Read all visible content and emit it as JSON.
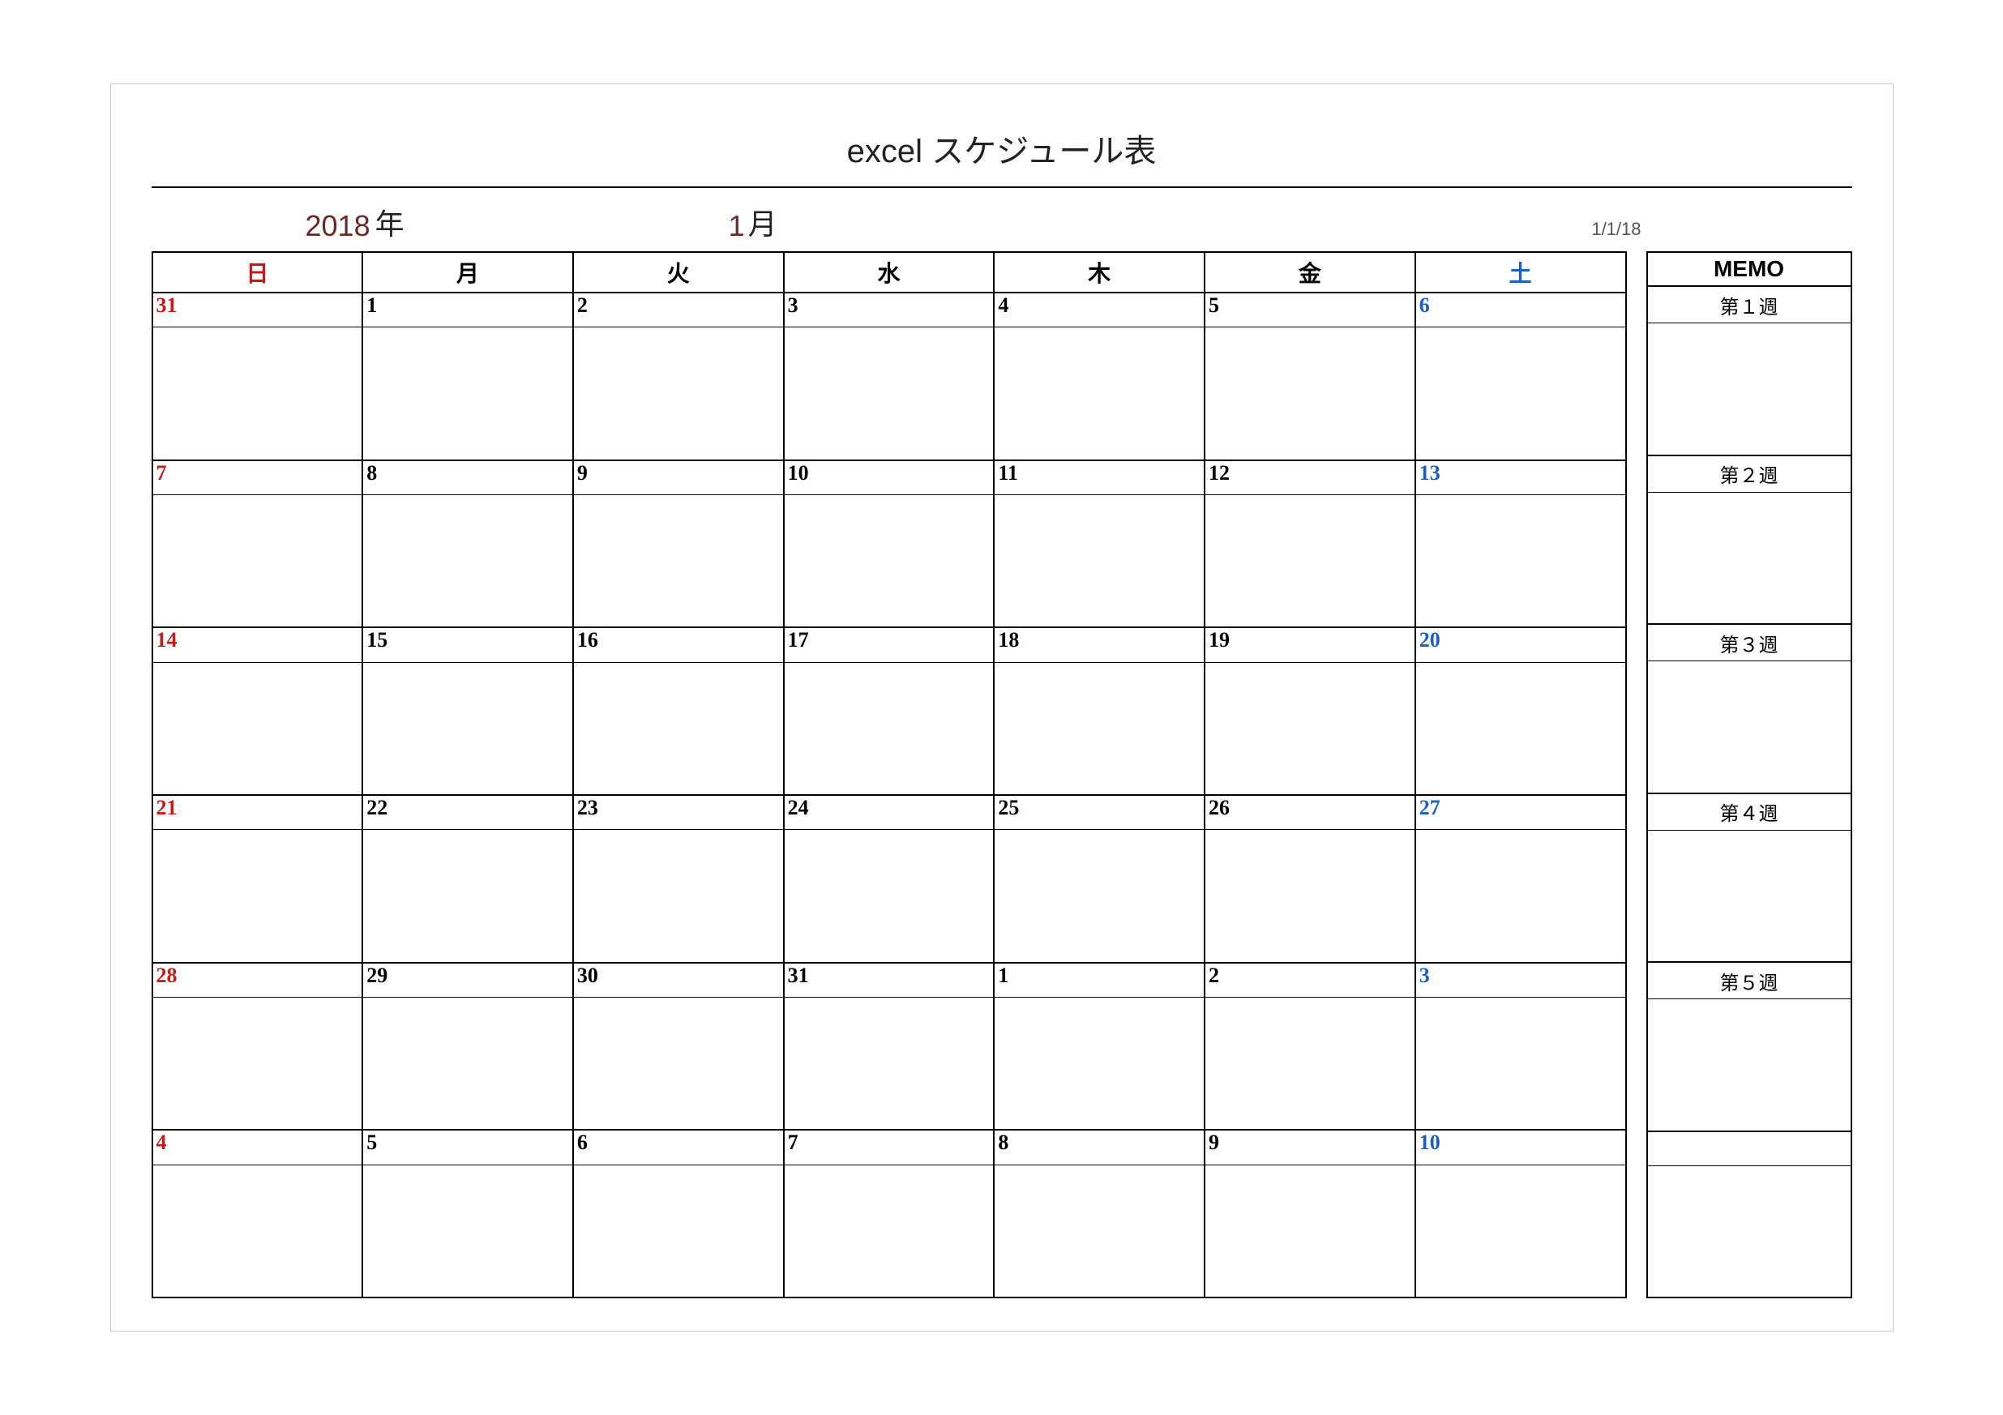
{
  "title": "excel スケジュール表",
  "year": "2018",
  "year_suffix": "年",
  "month": "1",
  "month_suffix": "月",
  "ref_date": "1/1/18",
  "day_headers": [
    "日",
    "月",
    "火",
    "水",
    "木",
    "金",
    "土"
  ],
  "memo_header": "MEMO",
  "weeks": [
    {
      "label": "第１週",
      "days": [
        {
          "n": "31",
          "cls": "sun"
        },
        {
          "n": "1",
          "cls": ""
        },
        {
          "n": "2",
          "cls": ""
        },
        {
          "n": "3",
          "cls": ""
        },
        {
          "n": "4",
          "cls": ""
        },
        {
          "n": "5",
          "cls": ""
        },
        {
          "n": "6",
          "cls": "sat"
        }
      ]
    },
    {
      "label": "第２週",
      "days": [
        {
          "n": "7",
          "cls": "sun"
        },
        {
          "n": "8",
          "cls": ""
        },
        {
          "n": "9",
          "cls": ""
        },
        {
          "n": "10",
          "cls": ""
        },
        {
          "n": "11",
          "cls": ""
        },
        {
          "n": "12",
          "cls": ""
        },
        {
          "n": "13",
          "cls": "sat"
        }
      ]
    },
    {
      "label": "第３週",
      "days": [
        {
          "n": "14",
          "cls": "sun"
        },
        {
          "n": "15",
          "cls": ""
        },
        {
          "n": "16",
          "cls": ""
        },
        {
          "n": "17",
          "cls": ""
        },
        {
          "n": "18",
          "cls": ""
        },
        {
          "n": "19",
          "cls": ""
        },
        {
          "n": "20",
          "cls": "sat"
        }
      ]
    },
    {
      "label": "第４週",
      "days": [
        {
          "n": "21",
          "cls": "sun"
        },
        {
          "n": "22",
          "cls": ""
        },
        {
          "n": "23",
          "cls": ""
        },
        {
          "n": "24",
          "cls": ""
        },
        {
          "n": "25",
          "cls": ""
        },
        {
          "n": "26",
          "cls": ""
        },
        {
          "n": "27",
          "cls": "sat"
        }
      ]
    },
    {
      "label": "第５週",
      "days": [
        {
          "n": "28",
          "cls": "sun"
        },
        {
          "n": "29",
          "cls": ""
        },
        {
          "n": "30",
          "cls": ""
        },
        {
          "n": "31",
          "cls": ""
        },
        {
          "n": "1",
          "cls": ""
        },
        {
          "n": "2",
          "cls": ""
        },
        {
          "n": "3",
          "cls": "sat"
        }
      ]
    },
    {
      "label": "",
      "days": [
        {
          "n": "4",
          "cls": "sun"
        },
        {
          "n": "5",
          "cls": ""
        },
        {
          "n": "6",
          "cls": ""
        },
        {
          "n": "7",
          "cls": ""
        },
        {
          "n": "8",
          "cls": ""
        },
        {
          "n": "9",
          "cls": ""
        },
        {
          "n": "10",
          "cls": "sat"
        }
      ]
    }
  ]
}
